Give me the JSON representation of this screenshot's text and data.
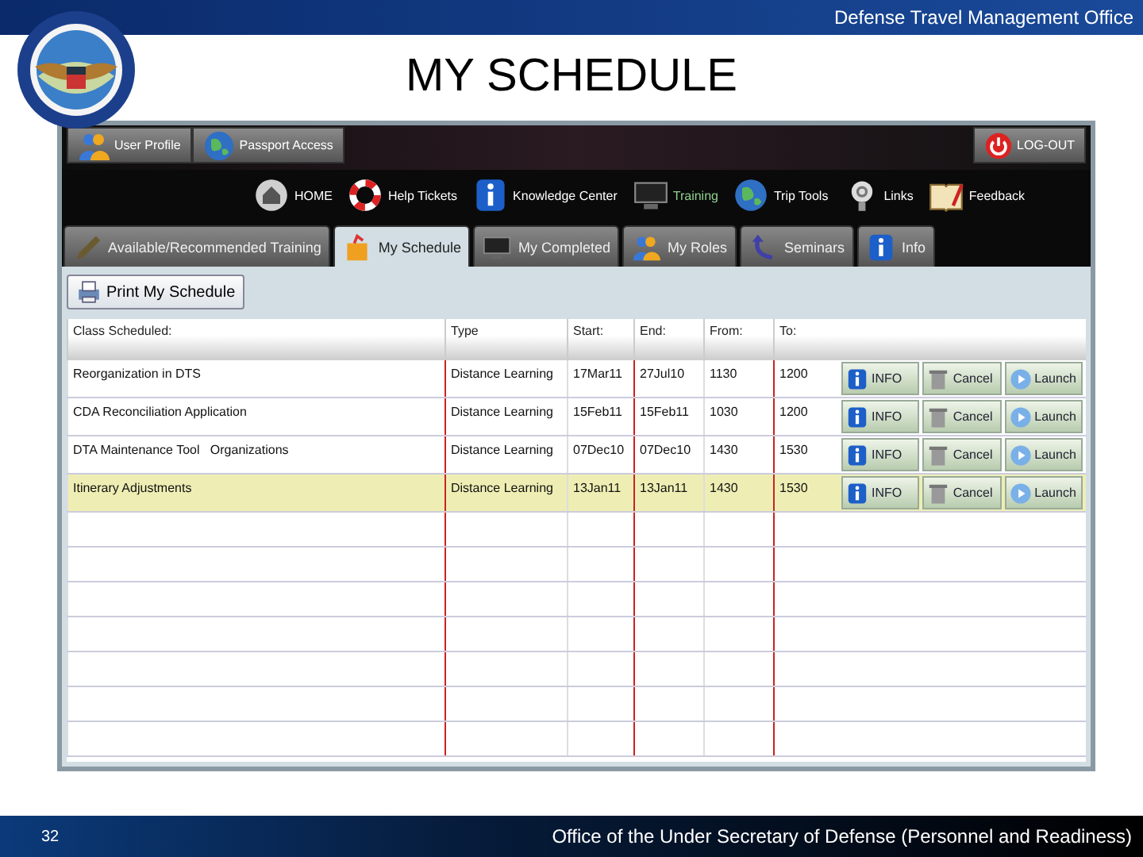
{
  "header": {
    "org": "Defense Travel Management Office"
  },
  "title": "MY SCHEDULE",
  "app": {
    "top_links": [
      {
        "label": "User Profile",
        "kind": "people"
      },
      {
        "label": "Passport Access",
        "kind": "globe"
      }
    ],
    "logout": "LOG-OUT",
    "nav": [
      {
        "label": "HOME",
        "kind": "home",
        "selected": false
      },
      {
        "label": "Help Tickets",
        "kind": "lifebuoy",
        "selected": false
      },
      {
        "label": "Knowledge Center",
        "kind": "info",
        "selected": false
      },
      {
        "label": "Training",
        "kind": "screen",
        "selected": true
      },
      {
        "label": "Trip Tools",
        "kind": "globe",
        "selected": false
      },
      {
        "label": "Links",
        "kind": "at",
        "selected": false
      },
      {
        "label": "Feedback",
        "kind": "book",
        "selected": false
      }
    ],
    "tabs": [
      {
        "label": "Available/Recommended Training",
        "kind": "pencil",
        "selected": false
      },
      {
        "label": "My Schedule",
        "kind": "box",
        "selected": true
      },
      {
        "label": "My Completed",
        "kind": "screen",
        "selected": false
      },
      {
        "label": "My Roles",
        "kind": "people",
        "selected": false
      },
      {
        "label": "Seminars",
        "kind": "arrow",
        "selected": false
      },
      {
        "label": "Info",
        "kind": "info",
        "selected": false
      }
    ],
    "print_button": "Print My Schedule",
    "table": {
      "columns": [
        "Class Scheduled:",
        "Type",
        "Start:",
        "End:",
        "From:",
        "To:"
      ],
      "rows": [
        {
          "cells": [
            "Reorganization in DTS",
            "Distance Learning",
            "17Mar11",
            "27Jul10",
            "1130",
            "1200"
          ],
          "actions": [
            "INFO",
            "Cancel",
            "Launch"
          ],
          "selected": false
        },
        {
          "cells": [
            "CDA Reconciliation Application",
            "Distance Learning",
            "15Feb11",
            "15Feb11",
            "1030",
            "1200"
          ],
          "actions": [
            "INFO",
            "Cancel",
            "Launch"
          ],
          "selected": false
        },
        {
          "cells": [
            "DTA Maintenance Tool   Organizations",
            "Distance Learning",
            "07Dec10",
            "07Dec10",
            "1430",
            "1530"
          ],
          "actions": [
            "INFO",
            "Cancel",
            "Launch"
          ],
          "selected": false
        },
        {
          "cells": [
            "Itinerary Adjustments",
            "Distance Learning",
            "13Jan11",
            "13Jan11",
            "1430",
            "1530"
          ],
          "actions": [
            "INFO",
            "Cancel",
            "Launch"
          ],
          "selected": true
        }
      ]
    }
  },
  "footer": {
    "page": "32",
    "office": "Office of the Under Secretary of Defense (Personnel and Readiness)"
  }
}
